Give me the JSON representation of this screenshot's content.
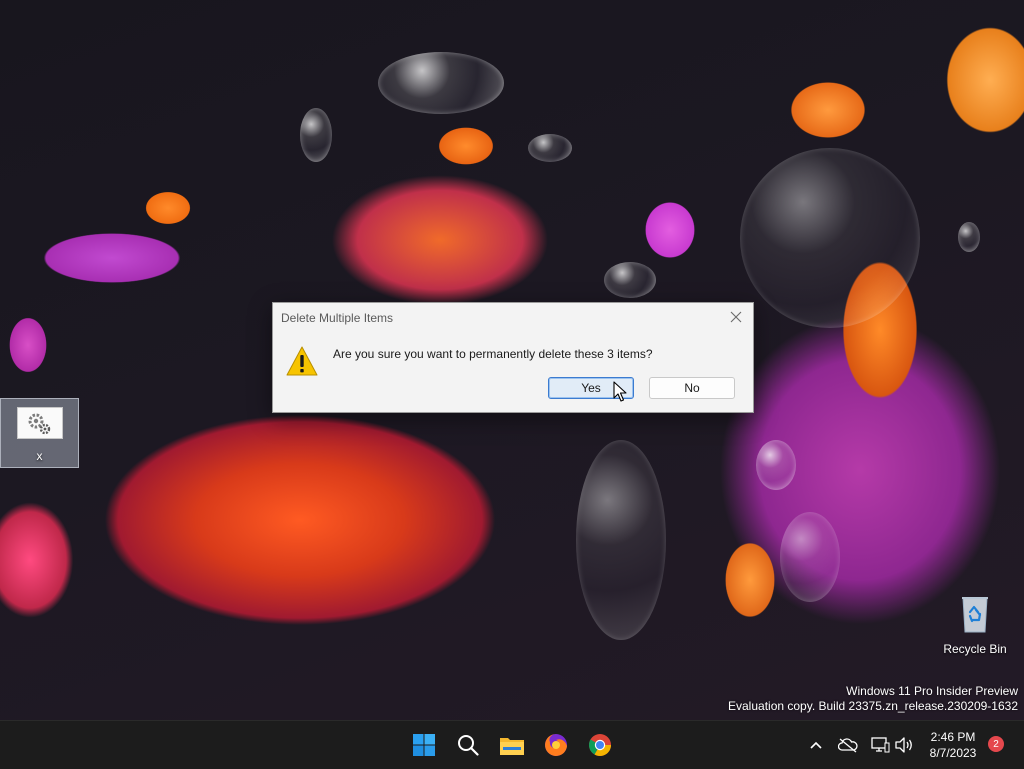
{
  "dialog": {
    "title": "Delete Multiple Items",
    "message": "Are you sure you want to permanently delete these 3 items?",
    "yes_label": "Yes",
    "no_label": "No",
    "icon": "warning-icon"
  },
  "desktop": {
    "selected_item_label": "x",
    "recycle_bin_label": "Recycle Bin",
    "watermark_line1": "Windows 11 Pro Insider Preview",
    "watermark_line2": "Evaluation copy. Build 23375.zn_release.230209-1632"
  },
  "taskbar": {
    "apps": [
      "start-icon",
      "search-icon",
      "file-explorer-icon",
      "firefox-icon",
      "chrome-icon"
    ],
    "tray": [
      "show-hidden-icons-chevron",
      "onedrive-offline-icon",
      "network-icon",
      "volume-icon"
    ],
    "time": "2:46 PM",
    "date": "8/7/2023",
    "notification_count": "2"
  },
  "colors": {
    "accent": "#0078d4",
    "taskbar": "#1c1c1c",
    "dialog_bg": "#f3f3f3",
    "warning": "#f7c400",
    "badge": "#e5484d"
  }
}
